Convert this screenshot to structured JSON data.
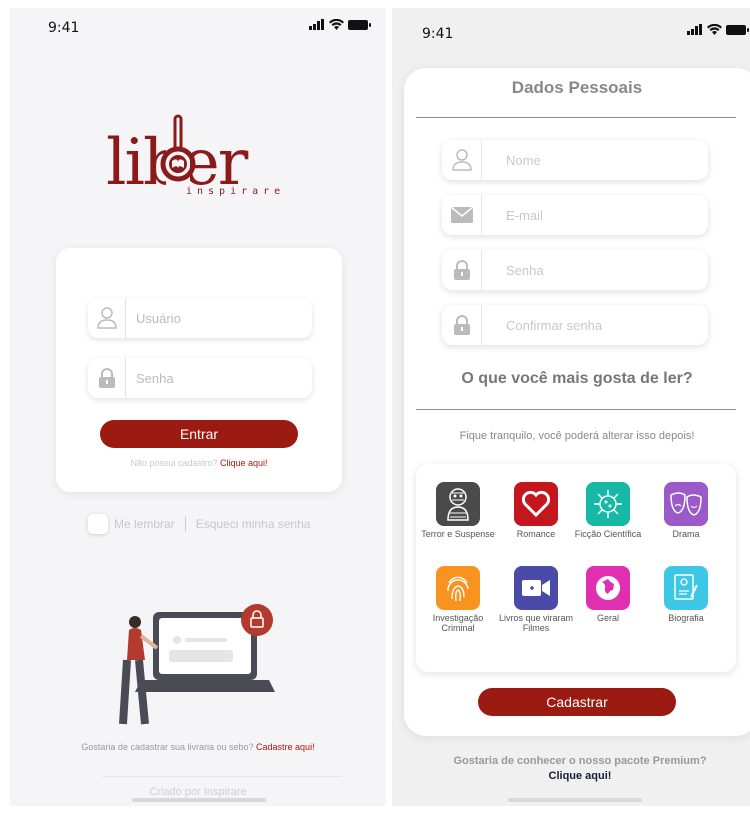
{
  "colors": {
    "brand": "#9b1b12",
    "link": "#b3140b"
  },
  "login": {
    "status_time": "9:41",
    "logo_text": "liber",
    "logo_tagline": "inspirare",
    "username_placeholder": "Usuário",
    "password_placeholder": "Senha",
    "enter_button": "Entrar",
    "no_account_text": "Não possui cadastro?",
    "no_account_link": "Clique aqui!",
    "remember_label": "Me lembrar",
    "forgot_password": "Esqueci minha senha",
    "bookstore_text": "Gostaria de cadastrar sua livraria ou sebo?",
    "bookstore_link": "Cadastre aqui!",
    "credits": "Criado por Inspirare"
  },
  "register": {
    "status_time": "9:41",
    "title": "Dados Pessoais",
    "fields": {
      "name_placeholder": "Nome",
      "email_placeholder": "E-mail",
      "password_placeholder": "Senha",
      "confirm_placeholder": "Confirmar senha"
    },
    "question": "O que você mais gosta de ler?",
    "note": "Fique tranquilo, você poderá alterar isso depois!",
    "genres": [
      {
        "label": "Terror e Suspense",
        "color": "#4a4a4a",
        "icon": "mummy-icon"
      },
      {
        "label": "Romance",
        "color": "#c4161c",
        "icon": "heart-icon"
      },
      {
        "label": "Ficção Científica",
        "color": "#16b9a5",
        "icon": "virus-icon"
      },
      {
        "label": "Drama",
        "color": "#9b59c9",
        "icon": "theater-masks-icon"
      },
      {
        "label": "Investigação Criminal",
        "color": "#f7931e",
        "icon": "fingerprint-icon"
      },
      {
        "label": "Livros que viraram Filmes",
        "color": "#4a4aa8",
        "icon": "video-camera-icon"
      },
      {
        "label": "Geral",
        "color": "#e02fb1",
        "icon": "globe-icon"
      },
      {
        "label": "Biografia",
        "color": "#3dc7e6",
        "icon": "biography-icon"
      }
    ],
    "submit_button": "Cadastrar",
    "premium_text": "Gostaria de conhecer o nosso pacote Premium?",
    "premium_link": "Clique aqui!"
  }
}
